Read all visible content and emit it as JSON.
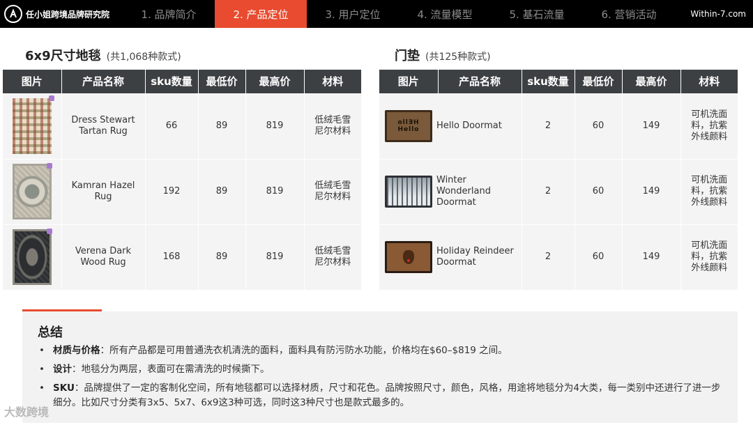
{
  "header": {
    "brand": "任小姐跨境品牌研究院",
    "tabs": [
      {
        "label": "1. 品牌简介"
      },
      {
        "label": "2. 产品定位"
      },
      {
        "label": "3. 用户定位"
      },
      {
        "label": "4. 流量模型"
      },
      {
        "label": "5. 基石流量"
      },
      {
        "label": "6. 营销活动"
      }
    ],
    "active_tab": 1,
    "site": "Within-7.com"
  },
  "left": {
    "title": "6x9尺寸地毯",
    "subtitle": "(共1,068种款式)",
    "columns": [
      "图片",
      "产品名称",
      "sku数量",
      "最低价",
      "最高价",
      "材料"
    ],
    "rows": [
      {
        "image": "plaid-rug-thumbnail",
        "name": "Dress Stewart Tartan Rug",
        "sku": "66",
        "min": "89",
        "max": "819",
        "material": "低绒毛雪尼尔材料"
      },
      {
        "image": "medallion-rug-thumbnail",
        "name": "Kamran Hazel Rug",
        "sku": "192",
        "min": "89",
        "max": "819",
        "material": "低绒毛雪尼尔材料"
      },
      {
        "image": "dark-rug-thumbnail",
        "name": "Verena Dark Wood Rug",
        "sku": "168",
        "min": "89",
        "max": "819",
        "material": "低绒毛雪尼尔材料"
      }
    ]
  },
  "right": {
    "title": "门垫",
    "subtitle": "(共125种款式)",
    "columns": [
      "图片",
      "产品名称",
      "sku数量",
      "最低价",
      "最高价",
      "材料"
    ],
    "rows": [
      {
        "image": "hello-doormat-thumbnail",
        "mat_text": "oll∃H Hello",
        "name": "Hello Doormat",
        "sku": "2",
        "min": "60",
        "max": "149",
        "material": "可机洗面料，抗紫外线颜料"
      },
      {
        "image": "winter-doormat-thumbnail",
        "name": "Winter Wonderland Doormat",
        "sku": "2",
        "min": "60",
        "max": "149",
        "material": "可机洗面料，抗紫外线颜料"
      },
      {
        "image": "reindeer-doormat-thumbnail",
        "name": "Holiday Reindeer Doormat",
        "sku": "2",
        "min": "60",
        "max": "149",
        "material": "可机洗面料，抗紫外线颜料"
      }
    ]
  },
  "summary": {
    "title": "总结",
    "items": [
      {
        "label": "材质与价格",
        "text": "：所有产品都是可用普通洗衣机清洗的面料，面料具有防污防水功能，价格均在$60–$819 之间。"
      },
      {
        "label": "设计",
        "text": "：地毯分为两层，表面可在需清洗的时候撕下。"
      },
      {
        "label": "SKU",
        "text": "：品牌提供了一定的客制化空间，所有地毯都可以选择材质，尺寸和花色。品牌按照尺寸，颜色，风格，用途将地毯分为4大类，每一类别中还进行了进一步细分。比如尺寸分类有3x5、5x7、6x9这3种可选，同时这3种尺寸也是款式最多的。"
      }
    ]
  },
  "watermark": "大数跨境",
  "colors": {
    "accent": "#e84b2f",
    "header_bg": "#000000",
    "table_header": "#3d4043",
    "cell_bg": "#f4f4f4"
  }
}
